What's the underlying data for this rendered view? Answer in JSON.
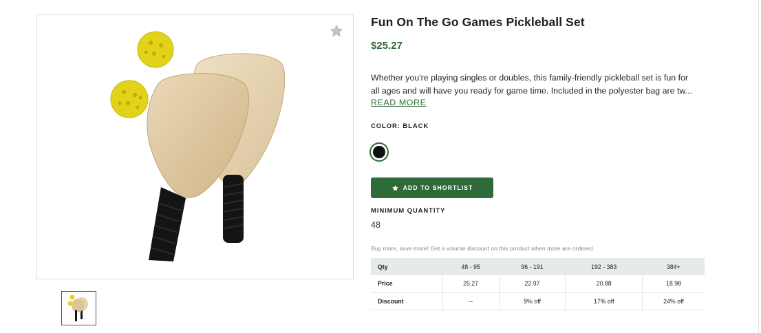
{
  "product": {
    "title": "Fun On The Go Games Pickleball Set",
    "price": "$25.27",
    "description_line1": "Whether you're playing singles or doubles, this family-friendly pickleball set is fun for",
    "description_line2": "all ages and will have you ready for game time. Included in the polyester bag are tw...",
    "read_more": "READ MORE"
  },
  "gallery": {
    "main_icon": "pickleball-paddles-image",
    "favorite_icon": "star-icon",
    "thumbnail_count": 1
  },
  "color": {
    "label": "COLOR: BLACK",
    "swatch_color": "#111111"
  },
  "actions": {
    "shortlist_label": "ADD TO SHORTLIST",
    "shortlist_icon": "star-icon"
  },
  "minimum_quantity": {
    "label": "MINIMUM QUANTITY",
    "value": "48"
  },
  "volume": {
    "note": "Buy more, save more! Get a volume discount on this product when more are ordered.",
    "headers": [
      "Qty",
      "48 - 95",
      "96 - 191",
      "192 - 383",
      "384+"
    ],
    "price_row": [
      "Price",
      "25.27",
      "22.97",
      "20.88",
      "18.98"
    ],
    "discount_row": [
      "Discount",
      "--",
      "9% off",
      "17% off",
      "24% off"
    ]
  },
  "colors": {
    "accent": "#2e6b39",
    "price": "#2f6b3a",
    "table_header_bg": "#e6ebe7"
  }
}
